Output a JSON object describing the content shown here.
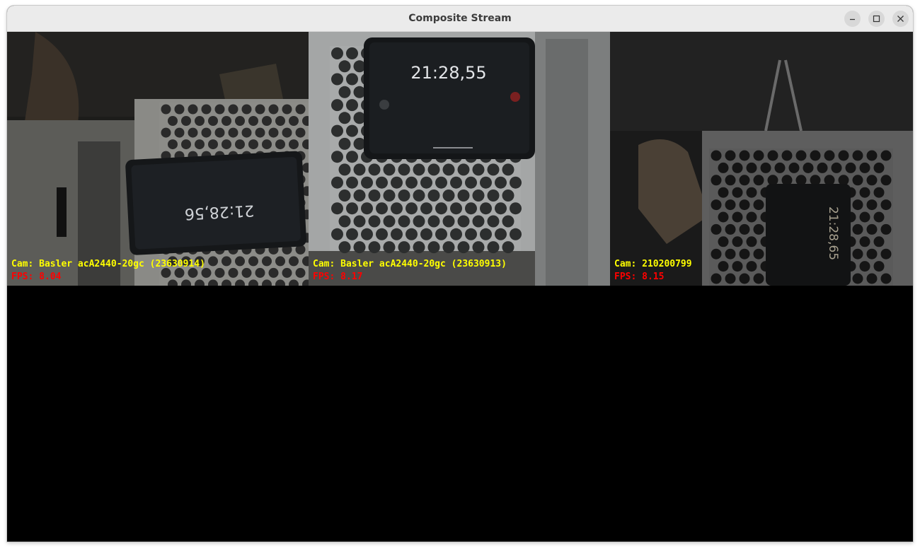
{
  "window": {
    "title": "Composite Stream"
  },
  "colors": {
    "cam_label": "#ffff00",
    "fps_label": "#ff0000",
    "background": "#000000"
  },
  "streams": [
    {
      "cam_label": "Cam: Basler acA2440-20gc (23630914)",
      "fps_label": "FPS: 8.04",
      "screen_time": "21:28,56"
    },
    {
      "cam_label": "Cam: Basler acA2440-20gc (23630913)",
      "fps_label": "FPS: 8.17",
      "screen_time": "21:28,55"
    },
    {
      "cam_label": "Cam: 210200799",
      "fps_label": "FPS: 8.15",
      "screen_time": "21:28,65"
    }
  ]
}
